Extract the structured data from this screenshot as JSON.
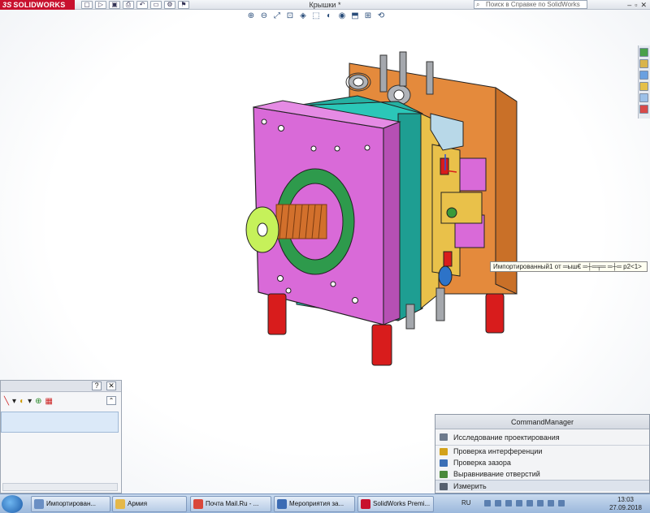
{
  "app": {
    "logo_text": "SOLIDWORKS",
    "logo_prefix": "3S",
    "document_title": "Крышки *",
    "help_search_placeholder": "Поиск в Справке по SolidWorks",
    "window_controls": [
      "–",
      "▫",
      "✕"
    ]
  },
  "quick_access": [
    "▢",
    "▷",
    "▣",
    "⎙",
    "↶",
    "▭",
    "⚙",
    "⚑"
  ],
  "heads_up_toolbar": [
    "⊕",
    "⊖",
    "⤢",
    "⊡",
    "◈",
    "⬚",
    "◐",
    "◉",
    "⬒",
    "⊞",
    "⟲"
  ],
  "panel": {
    "help_label": "?",
    "close_label": "✕",
    "collapse_label": "⌃",
    "tools": [
      "╲",
      "▾",
      "◐",
      "▾",
      "⊕",
      "▦"
    ],
    "status_text": ""
  },
  "tooltip": {
    "text": "Импортированный1 от ═ыш€ ═┼═╤═ ═┼═ р2<1>"
  },
  "command_manager": {
    "title": "CommandManager",
    "items": [
      {
        "label": "Исследование проектирования",
        "icon": "gear-icon",
        "color": "#6d7a8c"
      },
      {
        "label": "Проверка интерференции",
        "icon": "interference-icon",
        "color": "#d3a21b"
      },
      {
        "label": "Проверка зазора",
        "icon": "clearance-icon",
        "color": "#3b6fb6"
      },
      {
        "label": "Выравнивание отверстий",
        "icon": "hole-align-icon",
        "color": "#4a8a3b"
      },
      {
        "label": "Измерить",
        "icon": "measure-icon",
        "color": "#555f6e"
      }
    ]
  },
  "taskbar": {
    "items": [
      {
        "label": "Импортирован...",
        "icon": "search-icon",
        "color": "#6a8fc4"
      },
      {
        "label": "Армия",
        "icon": "folder-icon",
        "color": "#e5b84a"
      },
      {
        "label": "Почта Mail.Ru - ...",
        "icon": "chrome-icon",
        "color": "#d9483b"
      },
      {
        "label": "Мероприятия за...",
        "icon": "document-icon",
        "color": "#3c6cb4"
      },
      {
        "label": "SolidWorks Premi...",
        "icon": "solidworks-icon",
        "color": "#c8102e"
      }
    ],
    "language": "RU",
    "time": "13:03",
    "date": "27.09.2018"
  },
  "colors": {
    "front_plate": "#d96ad8",
    "teal_plate": "#2bc7b8",
    "orange_plate": "#e48a3c",
    "green_ring": "#2e9a4c",
    "legs": "#d81c1c",
    "yellow_block": "#e9c14a",
    "spring": "#d2702c",
    "nozzle_fill": "#c6f15a",
    "grey": "#a5a8ad"
  }
}
